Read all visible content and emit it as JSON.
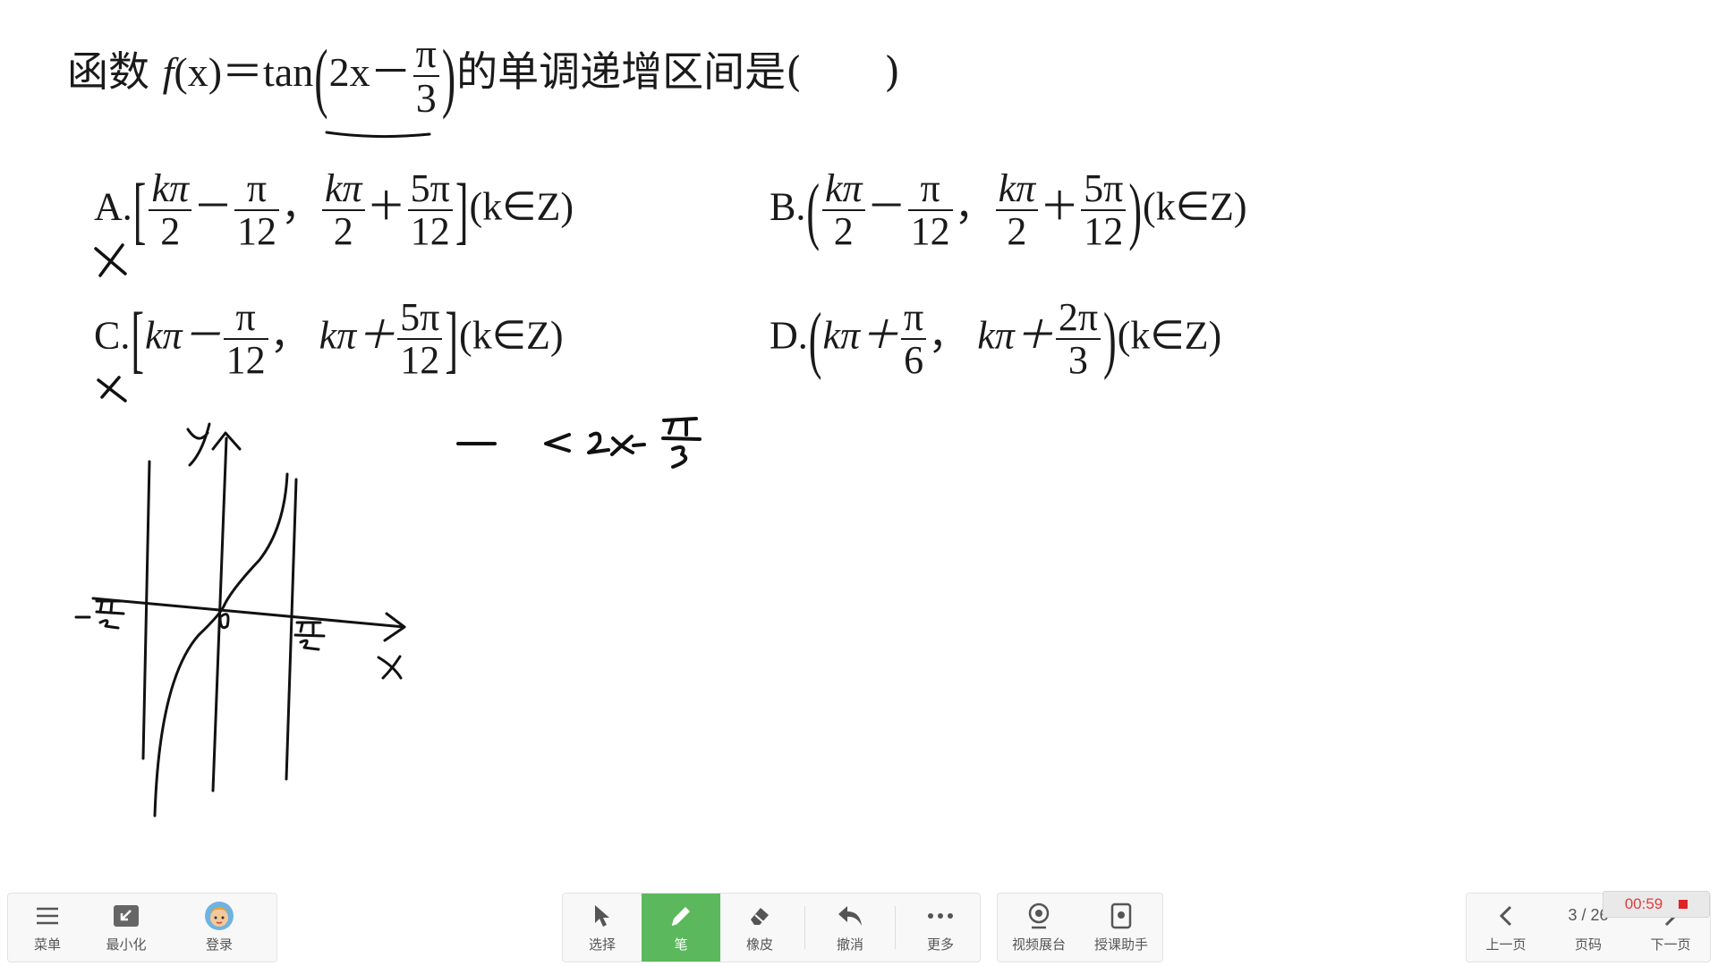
{
  "question": {
    "prefix": "函数 ",
    "func": "f",
    "arg": "(x)",
    "eq": "＝tan",
    "inner": "2x－",
    "pi": "π",
    "three": "3",
    "suffix": "的单调递增区间是(　　)"
  },
  "options": {
    "A": {
      "label": "A.",
      "lb": "[",
      "t1n": "kπ",
      "t1d": "2",
      "op1": "－",
      "f1n": "π",
      "f1d": "12",
      "comma": "，",
      "t2n": "kπ",
      "t2d": "2",
      "op2": "＋",
      "f2n": "5π",
      "f2d": "12",
      "rb": "]",
      "tail": "(k∈Z)"
    },
    "B": {
      "label": "B.",
      "lb": "(",
      "t1n": "kπ",
      "t1d": "2",
      "op1": "－",
      "f1n": "π",
      "f1d": "12",
      "comma": "，",
      "t2n": "kπ",
      "t2d": "2",
      "op2": "＋",
      "f2n": "5π",
      "f2d": "12",
      "rb": ")",
      "tail": "(k∈Z)"
    },
    "C": {
      "label": "C.",
      "lb": "[",
      "t1": "kπ－",
      "f1n": "π",
      "f1d": "12",
      "comma": "，",
      "t2": "kπ＋",
      "f2n": "5π",
      "f2d": "12",
      "rb": "]",
      "tail": "(k∈Z)"
    },
    "D": {
      "label": "D.",
      "lb": "(",
      "t1": "kπ＋",
      "f1n": "π",
      "f1d": "6",
      "comma": "，",
      "t2": "kπ＋",
      "f2n": "2π",
      "f2d": "3",
      "rb": ")",
      "tail": "(k∈Z)"
    }
  },
  "toolbar_left": [
    {
      "label": "菜单",
      "icon": "menu-icon"
    },
    {
      "label": "最小化",
      "icon": "minimize-icon"
    },
    {
      "label": "登录",
      "icon": "avatar-icon"
    }
  ],
  "toolbar_center": [
    {
      "label": "选择",
      "icon": "cursor-icon"
    },
    {
      "label": "笔",
      "icon": "pen-icon",
      "active": true
    },
    {
      "label": "橡皮",
      "icon": "eraser-icon"
    },
    {
      "label": "撤消",
      "icon": "undo-icon"
    },
    {
      "label": "更多",
      "icon": "more-icon"
    }
  ],
  "toolbar_right": [
    {
      "label": "视频展台",
      "icon": "camera-icon"
    },
    {
      "label": "授课助手",
      "icon": "assistant-icon"
    }
  ],
  "pager": {
    "prev": "上一页",
    "page": "3 / 26",
    "page_label": "页码",
    "next": "下一页"
  },
  "timer": "00:59",
  "colors": {
    "active": "#5cb85c",
    "timer": "#e23c3c",
    "ink": "#111111"
  }
}
